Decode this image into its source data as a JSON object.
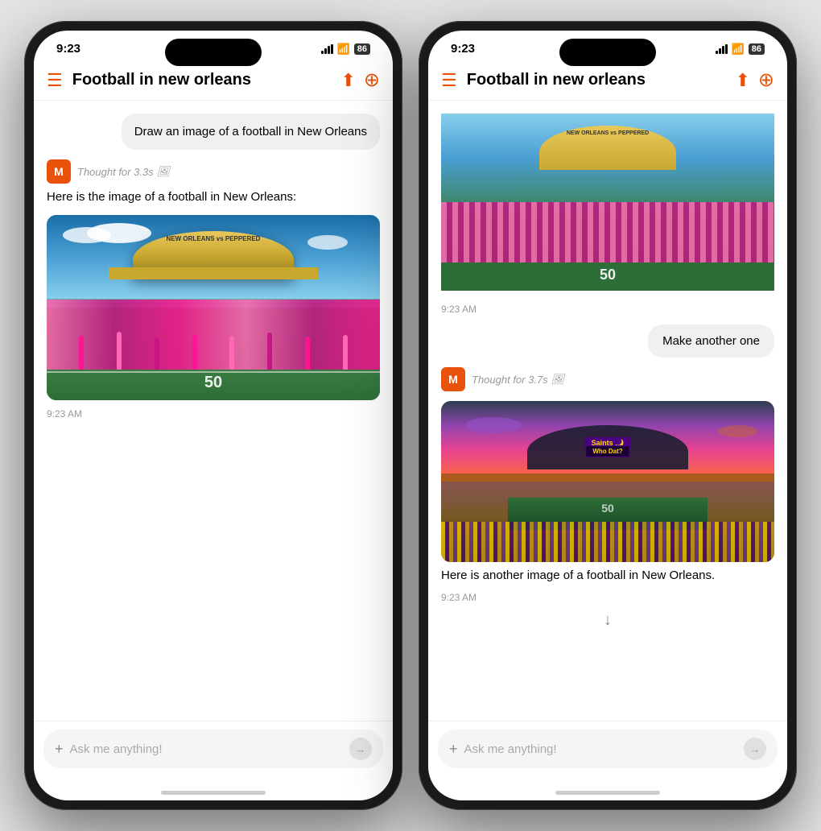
{
  "left_phone": {
    "status": {
      "time": "9:23",
      "battery": "86"
    },
    "header": {
      "title": "Football in new orleans"
    },
    "conversation": {
      "user_message": "Draw an image of a football in New Orleans",
      "ai_thought": "Thought for 3.3s",
      "ai_text": "Here is the image of a football in New Orleans:",
      "timestamp": "9:23 AM"
    },
    "input": {
      "placeholder": "Ask me anything!"
    }
  },
  "right_phone": {
    "status": {
      "time": "9:23",
      "battery": "86"
    },
    "header": {
      "title": "Football in new orleans"
    },
    "conversation": {
      "first_timestamp": "9:23 AM",
      "make_another": "Make another one",
      "ai_thought": "Thought for 3.7s",
      "ai_text": "Here is another image of a football in New Orleans.",
      "second_timestamp": "9:23 AM"
    },
    "input": {
      "placeholder": "Ask me anything!"
    }
  },
  "icons": {
    "menu": "☰",
    "share": "⬆",
    "add": "+",
    "send": "→",
    "camera": "🖼",
    "down_arrow": "↓"
  }
}
